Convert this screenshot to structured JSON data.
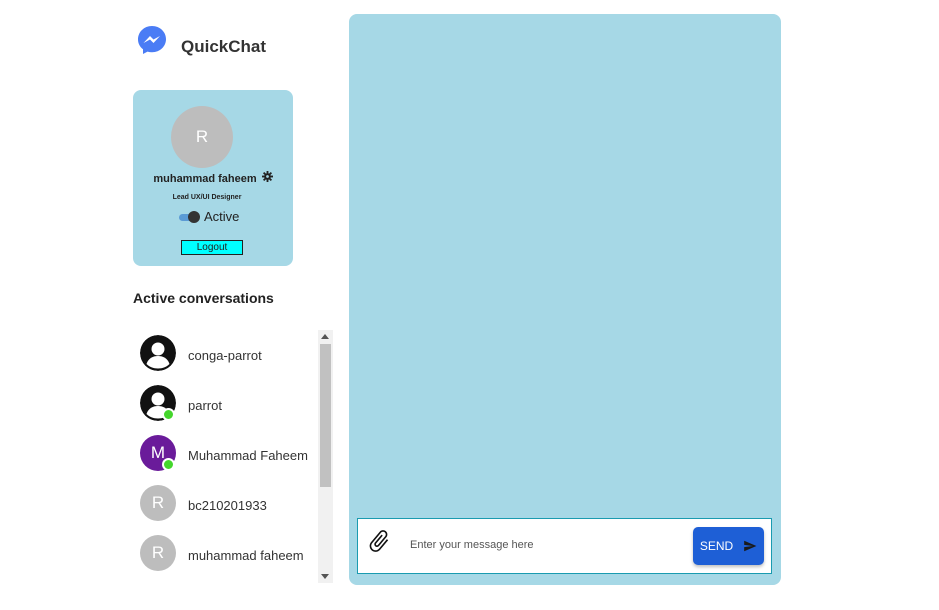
{
  "app": {
    "name": "QuickChat"
  },
  "profile": {
    "initial": "R",
    "name": "muhammad faheem",
    "role": "Lead UX/UI Designer",
    "status": "Active",
    "logout_label": "Logout"
  },
  "conversations": {
    "heading": "Active conversations",
    "items": [
      {
        "name": "conga-parrot",
        "avatar": "user-icon",
        "online": false
      },
      {
        "name": "parrot",
        "avatar": "user-icon",
        "online": true
      },
      {
        "name": "Muhammad Faheem",
        "initial": "M",
        "online": true
      },
      {
        "name": "bc210201933",
        "initial": "R",
        "online": false
      },
      {
        "name": "muhammad faheem",
        "initial": "R",
        "online": false
      }
    ]
  },
  "composer": {
    "placeholder": "Enter your message here",
    "send_label": "SEND"
  },
  "colors": {
    "panel_bg": "#a6d8e6",
    "send_button": "#1e5fd6",
    "logout_button": "#00ffff",
    "online": "#44d62c",
    "purple_avatar": "#6a1b9a"
  }
}
